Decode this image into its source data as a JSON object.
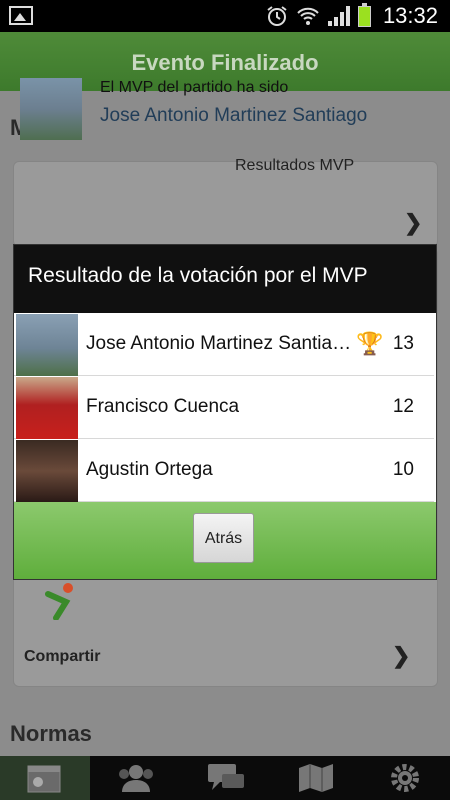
{
  "status_bar": {
    "time": "13:32",
    "icons": [
      "picture-icon",
      "alarm-icon",
      "wifi-icon",
      "signal-icon",
      "battery-icon"
    ]
  },
  "header": {
    "title": "Evento Finalizado"
  },
  "page": {
    "mvp_section_title": "MVP",
    "mvp_card": {
      "label": "El MVP del partido ha sido",
      "name": "Jose Antonio Martinez Santiago"
    },
    "hidden_results_label": "Resultados MVP",
    "share_label": "Compartir",
    "rules_section_title": "Normas"
  },
  "dialog": {
    "title": "Resultado de la votación por el MVP",
    "results": [
      {
        "name": "Jose Antonio Martinez Santia…",
        "votes": "13",
        "trophy": true
      },
      {
        "name": "Francisco Cuenca",
        "votes": "12",
        "trophy": false
      },
      {
        "name": "Agustin Ortega",
        "votes": "10",
        "trophy": false
      }
    ],
    "back_button": "Atrás"
  },
  "tab_bar": {
    "items": [
      "calendar-icon",
      "players-icon",
      "chat-icon",
      "map-icon",
      "settings-icon"
    ],
    "selected": 0
  },
  "colors": {
    "header_green": "#4f8b39",
    "dialog_footer": "#6fb84a",
    "name_blue": "#213d58"
  }
}
